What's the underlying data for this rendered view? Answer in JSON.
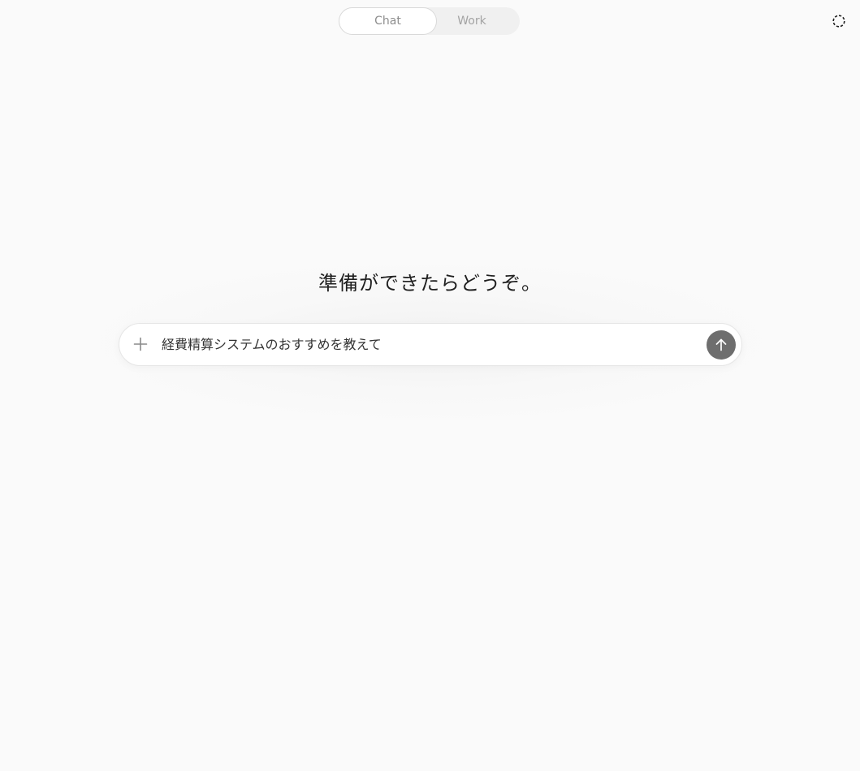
{
  "mode_toggle": {
    "tabs": [
      {
        "label": "Chat",
        "selected": true
      },
      {
        "label": "Work",
        "selected": false
      }
    ]
  },
  "top_right": {
    "icon": "loading-circle-icon"
  },
  "main": {
    "greeting": "準備ができたらどうぞ。"
  },
  "composer": {
    "value": "経費精算システムのおすすめを教えて",
    "add_icon": "plus-icon",
    "send_icon": "arrow-up-icon"
  },
  "colors": {
    "background": "#fafafa",
    "send_button": "#6e6e6e",
    "toggle_bg": "#f0f0f0"
  }
}
